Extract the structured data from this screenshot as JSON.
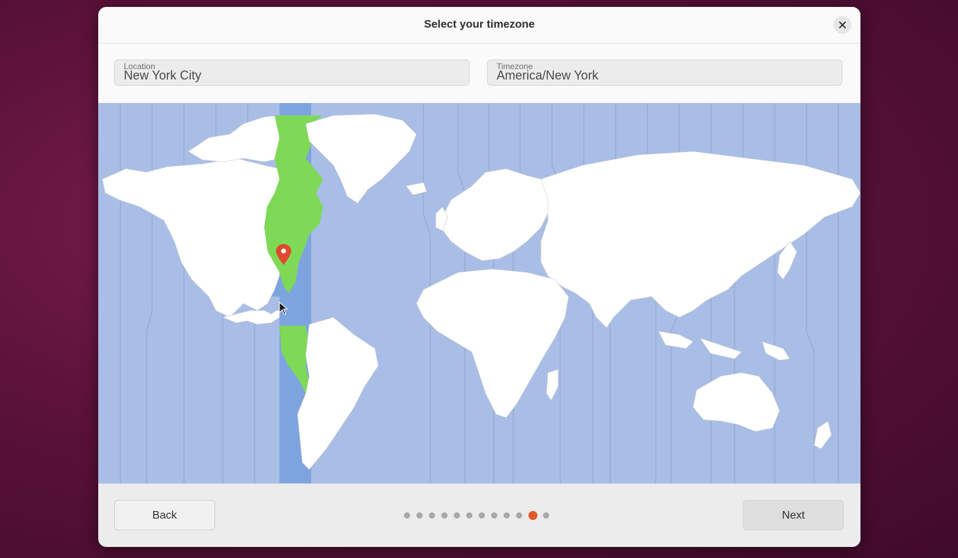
{
  "dialog": {
    "title": "Select your timezone",
    "close_icon": "close-icon"
  },
  "location": {
    "label": "Location",
    "value": "New York City"
  },
  "timezone": {
    "label": "Timezone",
    "value": "America/New York"
  },
  "map": {
    "selected_zone_color": "#7ea4e0",
    "selected_land_color": "#7ed957",
    "ocean_color": "#a9bee6",
    "land_color": "#ffffff",
    "pin_color": "#e0492c",
    "pin_icon": "map-pin-icon"
  },
  "footer": {
    "back_label": "Back",
    "next_label": "Next",
    "progress": {
      "total_steps": 12,
      "current_step": 11
    }
  },
  "colors": {
    "accent": "#e05a28"
  }
}
